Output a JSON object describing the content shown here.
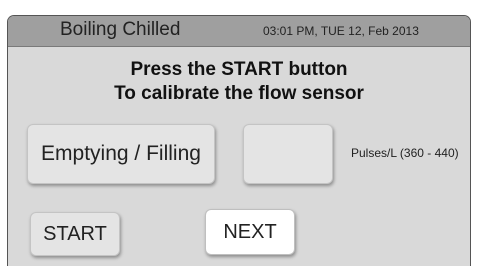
{
  "header": {
    "title": "Boiling Chilled",
    "clock": "03:01 PM, TUE 12, Feb 2013"
  },
  "instructions": {
    "line1": "Press the START button",
    "line2": "To calibrate the flow sensor"
  },
  "controls": {
    "mode_label": "Emptying / Filling",
    "value_display": "",
    "pulses_label": "Pulses/L (360 - 440)",
    "start_label": "START",
    "next_label": "NEXT"
  },
  "colors": {
    "header_bg": "#9f9f9f",
    "panel_bg": "#d9d9d9",
    "button_bg": "#e4e4e4",
    "next_button_bg": "#ffffff"
  }
}
